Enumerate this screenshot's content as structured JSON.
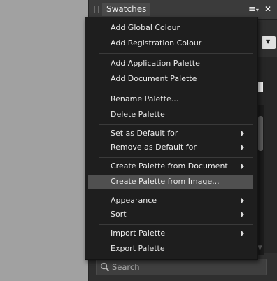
{
  "panel": {
    "tab_label": "Swatches",
    "menu_glyph": "≡",
    "menu_caret": "▾",
    "close_glyph": "✕",
    "search_placeholder": "Search"
  },
  "context_menu": {
    "items": [
      {
        "label": "Add Global Colour",
        "submenu": false
      },
      {
        "label": "Add Registration Colour",
        "submenu": false
      },
      {
        "label": "Add Application Palette",
        "submenu": false
      },
      {
        "label": "Add Document Palette",
        "submenu": false
      },
      {
        "label": "Rename Palette...",
        "submenu": false
      },
      {
        "label": "Delete Palette",
        "submenu": false
      },
      {
        "label": "Set as Default for",
        "submenu": true
      },
      {
        "label": "Remove as Default for",
        "submenu": true
      },
      {
        "label": "Create Palette from Document",
        "submenu": true
      },
      {
        "label": "Create Palette from Image...",
        "submenu": false,
        "highlighted": true
      },
      {
        "label": "Appearance",
        "submenu": true
      },
      {
        "label": "Sort",
        "submenu": true
      },
      {
        "label": "Import Palette",
        "submenu": true
      },
      {
        "label": "Export Palette",
        "submenu": false
      }
    ]
  },
  "colors": {
    "menu_bg": "#1e1e1e",
    "highlight": "#505050",
    "panel_bg": "#2f2f2f"
  }
}
